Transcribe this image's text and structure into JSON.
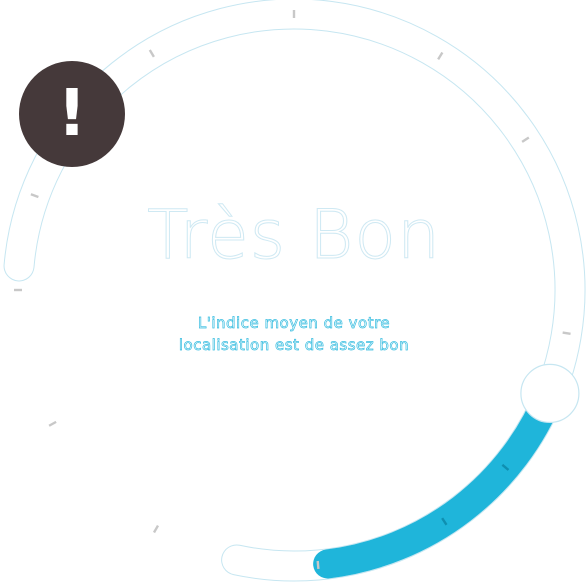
{
  "gauge": {
    "level_text": "Très Bon",
    "description": "L'indice moyen de votre localisation est de assez bon",
    "fill_fraction": 0.22,
    "tick_count": 15,
    "colors": {
      "fill": "#1fb5da",
      "track_border": "#c6e6f1",
      "tick": "#c8c8c8",
      "alert_bg": "#45393a"
    }
  },
  "alert": {
    "icon": "exclamation-icon",
    "glyph": "!"
  }
}
